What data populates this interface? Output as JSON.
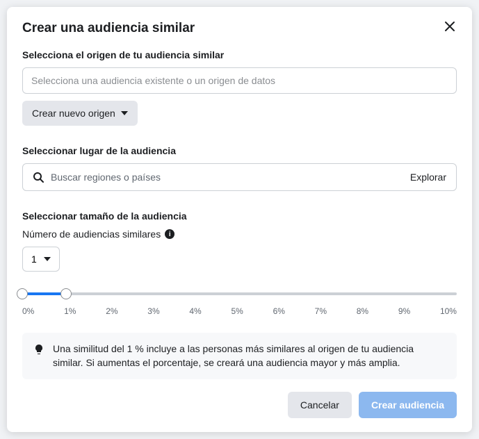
{
  "title": "Crear una audiencia similar",
  "source": {
    "label": "Selecciona el origen de tu audiencia similar",
    "placeholder": "Selecciona una audiencia existente o un origen de datos",
    "newBtn": "Crear nuevo origen"
  },
  "location": {
    "label": "Seleccionar lugar de la audiencia",
    "placeholder": "Buscar regiones o países",
    "browse": "Explorar"
  },
  "size": {
    "label": "Seleccionar tamaño de la audiencia",
    "countLabel": "Número de audiencias similares",
    "count": "1",
    "ticks": [
      "0%",
      "1%",
      "2%",
      "3%",
      "4%",
      "5%",
      "6%",
      "7%",
      "8%",
      "9%",
      "10%"
    ]
  },
  "tip": "Una similitud del 1 % incluye a las personas más similares al origen de tu audiencia similar. Si aumentas el porcentaje, se creará una audiencia mayor y más amplia.",
  "footer": {
    "cancel": "Cancelar",
    "create": "Crear audiencia"
  }
}
